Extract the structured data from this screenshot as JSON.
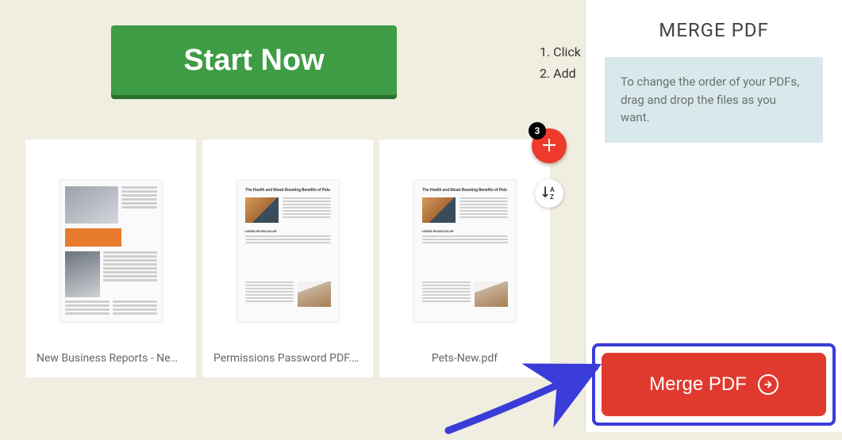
{
  "header": {
    "start_now_label": "Start Now"
  },
  "instructions": {
    "items": [
      "1. Click",
      "2. Add"
    ]
  },
  "files": {
    "items": [
      {
        "name": "New Business Reports - New F…"
      },
      {
        "name": "Permissions Password PDF.pdf"
      },
      {
        "name": "Pets-New.pdf"
      }
    ],
    "thumb_article_title": "The Health and Mood-Boosting Benefits of Pets"
  },
  "controls": {
    "add_badge_count": "3",
    "sort_label": "A\nZ"
  },
  "sidebar": {
    "title": "MERGE PDF",
    "tip": "To change the order of your PDFs, drag and drop the files as you want.",
    "merge_label": "Merge PDF"
  },
  "colors": {
    "accent_green": "#3e9c44",
    "accent_red": "#e03a2f",
    "highlight_blue": "#3a3cd8"
  }
}
